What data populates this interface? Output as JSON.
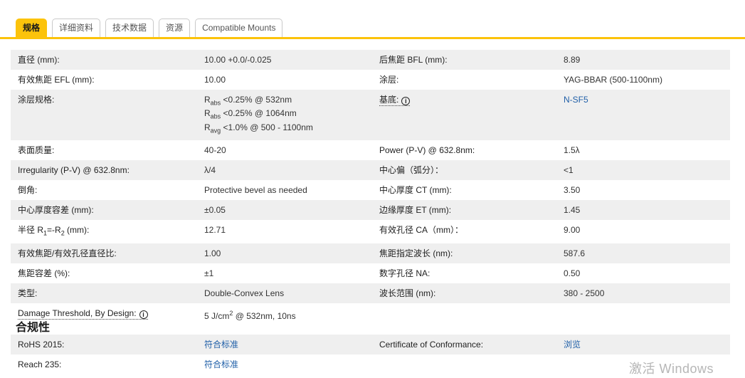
{
  "tabs": {
    "items": [
      {
        "label": "规格",
        "active": true
      },
      {
        "label": "详细资料",
        "active": false
      },
      {
        "label": "技术数据",
        "active": false
      },
      {
        "label": "资源",
        "active": false
      },
      {
        "label": "Compatible Mounts",
        "active": false
      }
    ]
  },
  "colors": {
    "accent_yellow": "#fcc30b",
    "link_blue": "#2160a8",
    "row_gray": "#efefef",
    "watermark_gray": "#b6b6b6"
  },
  "spec": {
    "rows": [
      {
        "l1": "直径 (mm):",
        "v1": "10.00 +0.0/-0.025",
        "l2": "后焦距 BFL (mm):",
        "v2": "8.89"
      },
      {
        "l1": "有效焦距 EFL (mm):",
        "v1": "10.00",
        "l2": "涂层:",
        "v2": "YAG-BBAR (500-1100nm)"
      },
      {
        "l1": "涂层规格:",
        "v1_rich": "R<sub>abs</sub> &lt;0.25% @ 532nm<br>R<sub>abs</sub> &lt;0.25% @ 1064nm<br>R<sub>avg</sub> &lt;1.0% @ 500 - 1100nm",
        "l2": "基底:",
        "v2": "N-SF5"
      },
      {
        "l1": "表面质量:",
        "v1": "40-20",
        "l2": "Power (P-V) @ 632.8nm:",
        "v2": "1.5λ"
      },
      {
        "l1": "Irregularity (P-V) @ 632.8nm:",
        "v1": "λ/4",
        "l2": "中心偏（弧分）：",
        "v2": "<1"
      },
      {
        "l1": "倒角:",
        "v1": "Protective bevel as needed",
        "l2": "中心厚度 CT (mm):",
        "v2": "3.50"
      },
      {
        "l1": "中心厚度容差 (mm):",
        "v1": "±0.05",
        "l2": "边缘厚度 ET (mm):",
        "v2": "1.45"
      },
      {
        "l1_rich": "半径 R<sub>1</sub>=-R<sub>2</sub> (mm):",
        "v1": "12.71",
        "l2": "有效孔径 CA（mm）：",
        "v2": "9.00"
      },
      {
        "l1": "有效焦距/有效孔径直径比:",
        "v1": "1.00",
        "l2": "焦距指定波长 (nm):",
        "v2": "587.6"
      },
      {
        "l1": "焦距容差 (%):",
        "v1": "±1",
        "l2": "数字孔径 NA:",
        "v2": "0.50"
      },
      {
        "l1": "类型:",
        "v1": "Double-Convex Lens",
        "l2": "波长范围 (nm):",
        "v2": "380 - 2500"
      },
      {
        "l1": "Damage Threshold, By Design:",
        "v1_rich": "5 J/cm<sup>2</sup> @ 532nm, 10ns",
        "l2": "",
        "v2": ""
      }
    ]
  },
  "compliance": {
    "heading": "合规性",
    "rows": [
      {
        "l1": "RoHS 2015:",
        "v1": "符合标准",
        "l2": "Certificate of Conformance:",
        "v2": "浏览"
      },
      {
        "l1": "Reach 235:",
        "v1": "符合标准",
        "l2": "",
        "v2": ""
      }
    ]
  },
  "watermark": {
    "text": "激活 Windows"
  }
}
